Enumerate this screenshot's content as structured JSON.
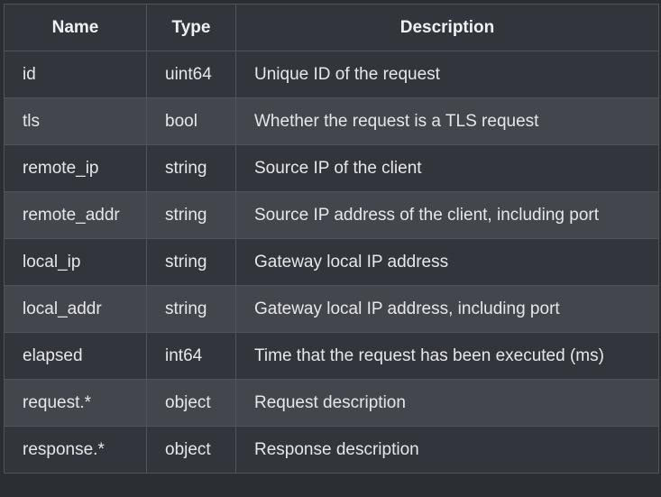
{
  "table": {
    "headers": {
      "name": "Name",
      "type": "Type",
      "description": "Description"
    },
    "rows": [
      {
        "name": "id",
        "type": "uint64",
        "description": "Unique ID of the request"
      },
      {
        "name": "tls",
        "type": "bool",
        "description": "Whether the request is a TLS request"
      },
      {
        "name": "remote_ip",
        "type": "string",
        "description": "Source IP of the client"
      },
      {
        "name": "remote_addr",
        "type": "string",
        "description": "Source IP address of the client, including port"
      },
      {
        "name": "local_ip",
        "type": "string",
        "description": "Gateway local IP address"
      },
      {
        "name": "local_addr",
        "type": "string",
        "description": "Gateway local IP address, including port"
      },
      {
        "name": "elapsed",
        "type": "int64",
        "description": "Time that the request has been executed (ms)"
      },
      {
        "name": "request.*",
        "type": "object",
        "description": "Request description"
      },
      {
        "name": "response.*",
        "type": "object",
        "description": "Response description"
      }
    ]
  }
}
